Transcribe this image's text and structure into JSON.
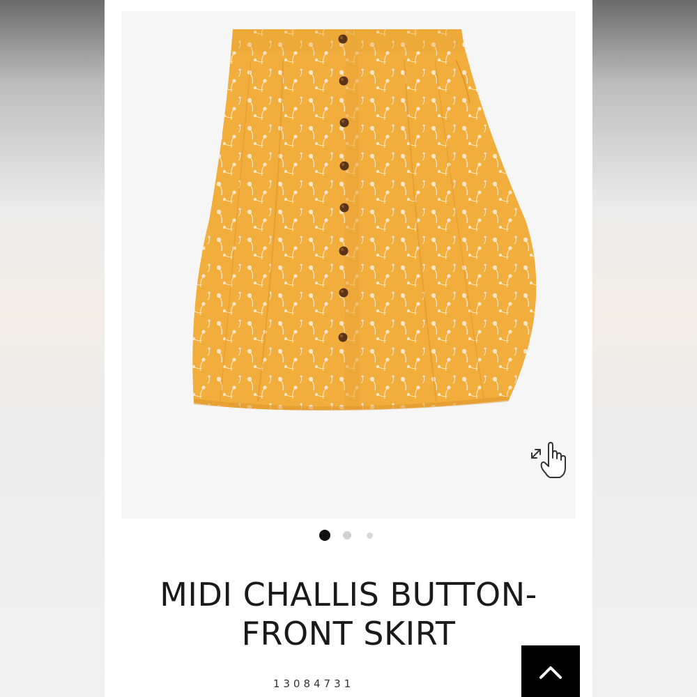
{
  "product": {
    "title": "MIDI CHALLIS BUTTON-FRONT SKIRT",
    "sku": "13084731"
  },
  "gallery": {
    "image_alt": "Midi challis button-front skirt, yellow with white floral print",
    "total_images": 3,
    "active_index": 0,
    "zoom_icon": "pinch-zoom-hand-icon"
  },
  "controls": {
    "back_to_top_icon": "chevron-up-icon"
  },
  "colors": {
    "skirt": "#f2ae3d",
    "print": "#fbe6c4",
    "buttons": "#5a3418",
    "active_dot": "#111111",
    "inactive_dot": "#d2d2d2",
    "back_to_top_bg": "#000000"
  }
}
